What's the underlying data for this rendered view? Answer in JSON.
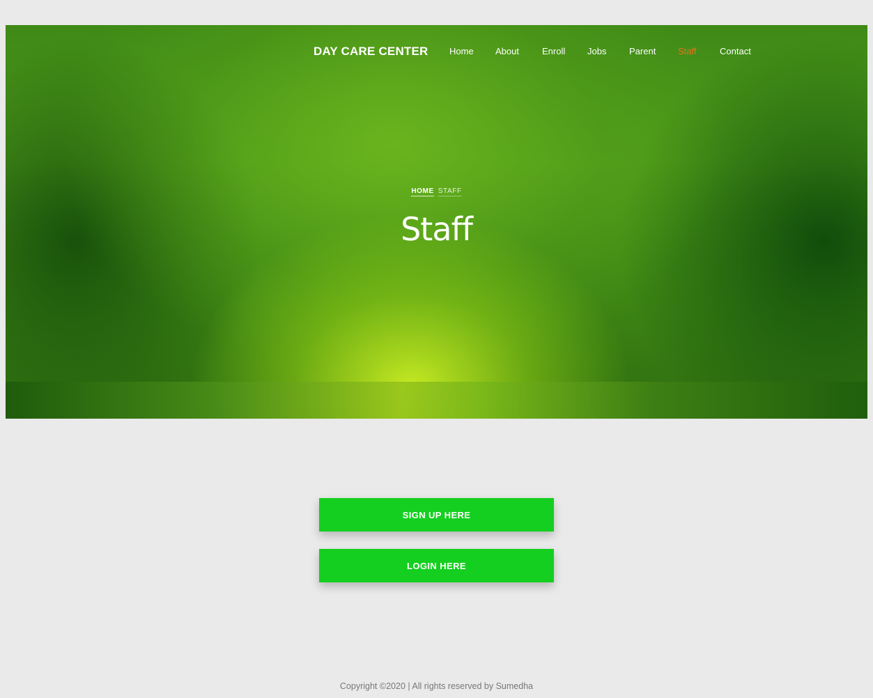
{
  "navbar": {
    "brand": "DAY CARE CENTER",
    "links": [
      {
        "label": "Home"
      },
      {
        "label": "About"
      },
      {
        "label": "Enroll"
      },
      {
        "label": "Jobs"
      },
      {
        "label": "Parent"
      },
      {
        "label": "Staff",
        "active": true
      },
      {
        "label": "Contact"
      }
    ],
    "active_color": "#e8731c"
  },
  "hero": {
    "breadcrumb": {
      "home": "HOME",
      "current": "STAFF"
    },
    "title": "Staff"
  },
  "actions": {
    "signup_label": "SIGN UP HERE",
    "login_label": "LOGIN HERE",
    "button_color": "#14cf1f"
  },
  "footer": {
    "copyright": "Copyright ©2020 | All rights reserved by Sumedha"
  }
}
